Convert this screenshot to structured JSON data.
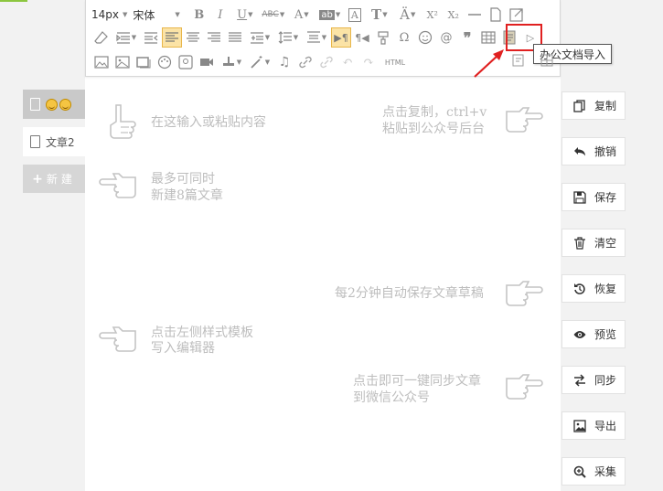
{
  "sidebar": {
    "tab1": {
      "label": "",
      "icons": [
        "document-icon",
        "emoji-icon",
        "emoji-icon"
      ]
    },
    "tab2": {
      "label": "文章2"
    },
    "new_button": {
      "label": "新建"
    }
  },
  "toolbar": {
    "font_size": "14px",
    "font_family": "宋体",
    "html_label": "HTML",
    "tooltip": "办公文档导入"
  },
  "hints": {
    "input": "在这输入或粘贴内容",
    "copy_line1": "点击复制，ctrl+v",
    "copy_line2": "粘贴到公众号后台",
    "max_line1": "最多可同时",
    "max_line2": "新建8篇文章",
    "autosave": "每2分钟自动保存文章草稿",
    "template_line1": "点击左侧样式模板",
    "template_line2": "写入编辑器",
    "sync_line1": "点击即可一键同步文章",
    "sync_line2": "到微信公众号"
  },
  "actions": [
    {
      "label": "复制",
      "icon": "copy-icon"
    },
    {
      "label": "撤销",
      "icon": "undo-icon"
    },
    {
      "label": "保存",
      "icon": "save-icon"
    },
    {
      "label": "清空",
      "icon": "trash-icon"
    },
    {
      "label": "恢复",
      "icon": "restore-icon"
    },
    {
      "label": "预览",
      "icon": "eye-icon"
    },
    {
      "label": "同步",
      "icon": "sync-icon"
    },
    {
      "label": "导出",
      "icon": "export-image-icon"
    },
    {
      "label": "采集",
      "icon": "search-plus-icon"
    }
  ],
  "colors": {
    "accent_green": "#8cc63f",
    "highlight_red": "#e02020",
    "active_button": "#fbe3a6",
    "hint_text": "#bdbdbd"
  }
}
